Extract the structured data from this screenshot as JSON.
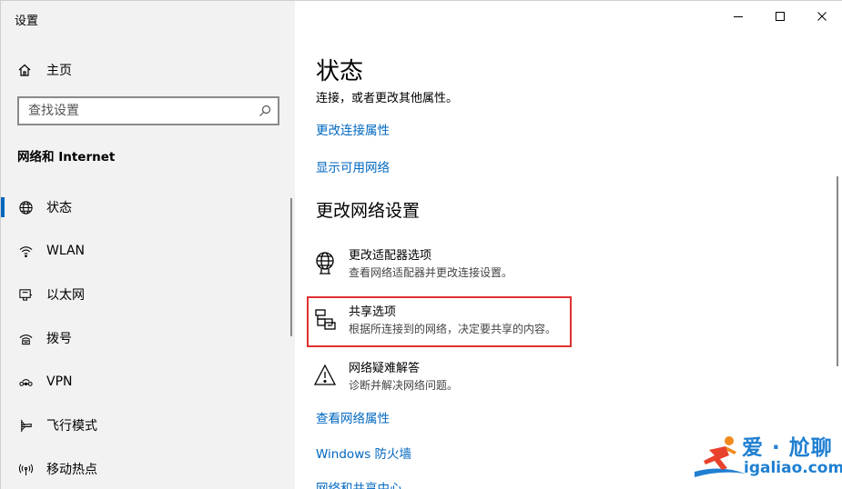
{
  "window": {
    "title": "设置"
  },
  "sidebar": {
    "home_label": "主页",
    "search_placeholder": "查找设置",
    "section_title": "网络和 Internet",
    "items": [
      {
        "label": "状态",
        "icon": "globe-icon",
        "active": true
      },
      {
        "label": "WLAN",
        "icon": "wifi-icon"
      },
      {
        "label": "以太网",
        "icon": "ethernet-icon"
      },
      {
        "label": "拨号",
        "icon": "dialup-icon"
      },
      {
        "label": "VPN",
        "icon": "vpn-icon"
      },
      {
        "label": "飞行模式",
        "icon": "airplane-icon"
      },
      {
        "label": "移动热点",
        "icon": "hotspot-icon"
      }
    ]
  },
  "main": {
    "title": "状态",
    "subtitle": "连接，或者更改其他属性。",
    "links_top": [
      "更改连接属性",
      "显示可用网络"
    ],
    "section_title": "更改网络设置",
    "options": [
      {
        "title": "更改适配器选项",
        "desc": "查看网络适配器并更改连接设置。",
        "icon": "adapter-icon"
      },
      {
        "title": "共享选项",
        "desc": "根据所连接到的网络，决定要共享的内容。",
        "icon": "sharing-icon"
      },
      {
        "title": "网络疑难解答",
        "desc": "诊断并解决网络问题。",
        "icon": "warning-icon"
      }
    ],
    "links_bottom": [
      "查看网络属性",
      "Windows 防火墙",
      "网络和共享中心"
    ]
  },
  "watermark": {
    "cn": "爱 · 尬聊",
    "en": "igaliao.com"
  },
  "colors": {
    "accent": "#0067c0",
    "highlight": "#e03131",
    "sidebar_bg": "#f2f2f2",
    "watermark": "#1f7fd1"
  }
}
